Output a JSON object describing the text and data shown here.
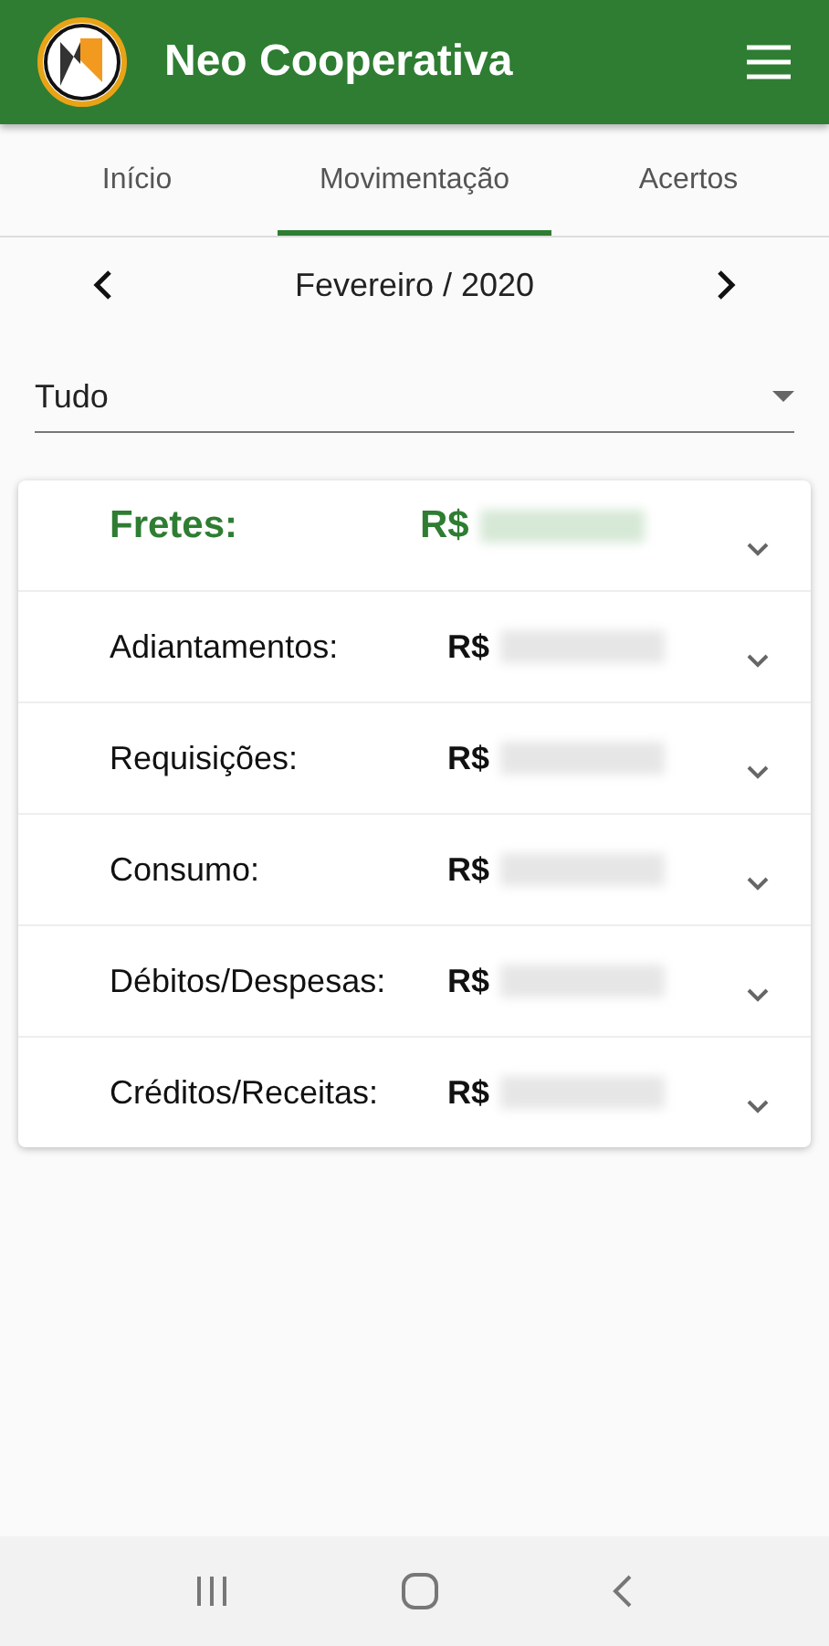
{
  "app_bar": {
    "title": "Neo Cooperativa"
  },
  "tabs": [
    {
      "label": "Início",
      "selected": false
    },
    {
      "label": "Movimentação",
      "selected": true
    },
    {
      "label": "Acertos",
      "selected": false
    }
  ],
  "period": {
    "label": "Fevereiro / 2020"
  },
  "filter": {
    "value": "Tudo"
  },
  "summary": [
    {
      "kind": "main",
      "label": "Fretes:",
      "currency": "R$",
      "expanded": false
    },
    {
      "kind": "item",
      "label": "Adiantamentos:",
      "currency": "R$",
      "expanded": false
    },
    {
      "kind": "item",
      "label": "Requisições:",
      "currency": "R$",
      "expanded": false
    },
    {
      "kind": "item",
      "label": "Consumo:",
      "currency": "R$",
      "expanded": false
    },
    {
      "kind": "item",
      "label": "Débitos/Despesas:",
      "currency": "R$",
      "expanded": false
    },
    {
      "kind": "item",
      "label": "Créditos/Receitas:",
      "currency": "R$",
      "expanded": false
    }
  ]
}
